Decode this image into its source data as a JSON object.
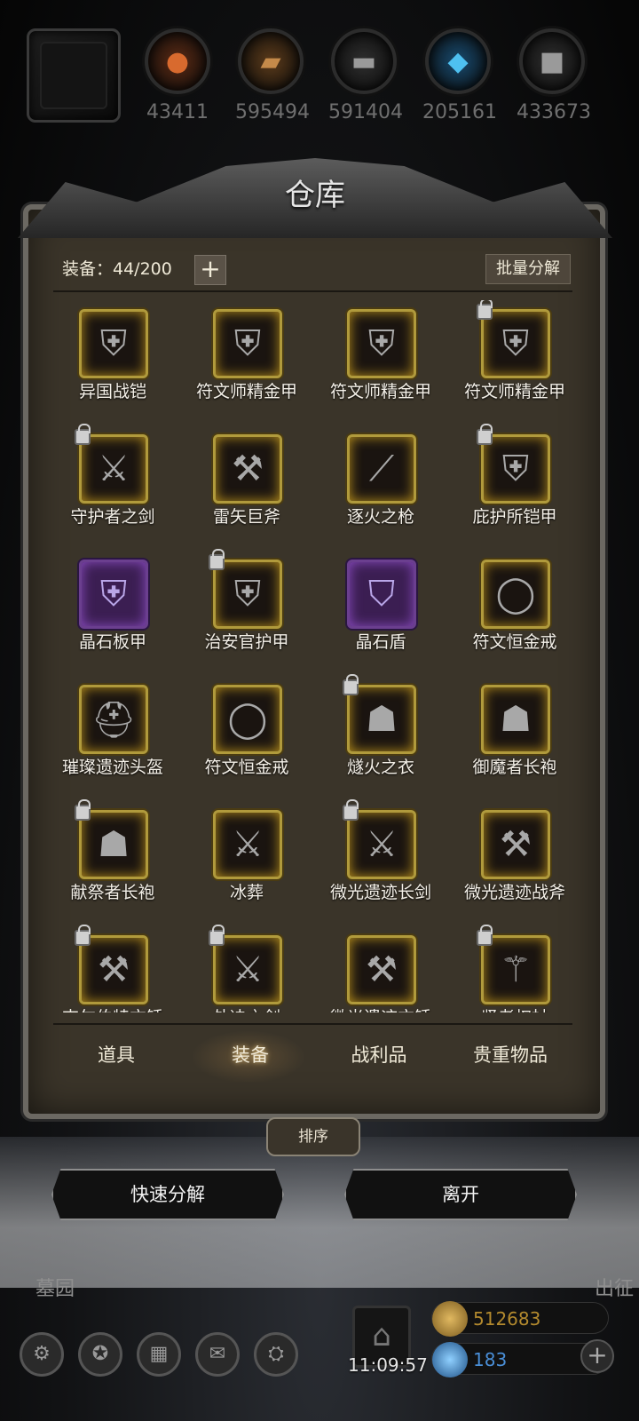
{
  "resources": [
    {
      "icon": "ore-icon",
      "glyph": "●",
      "value": "43411"
    },
    {
      "icon": "wood-icon",
      "glyph": "▰",
      "value": "595494"
    },
    {
      "icon": "iron-icon",
      "glyph": "▬",
      "value": "591404"
    },
    {
      "icon": "crystal-icon",
      "glyph": "◆",
      "value": "205161"
    },
    {
      "icon": "stone-icon",
      "glyph": "■",
      "value": "433673"
    }
  ],
  "panel": {
    "title": "仓库",
    "count_label": "装备：44/200",
    "add_label": "+",
    "batch_label": "批量分解"
  },
  "items": [
    {
      "name": "异国战铠",
      "icon": "armor-icon",
      "glyph": "⛨",
      "locked": false,
      "epic": false
    },
    {
      "name": "符文师精金甲",
      "icon": "armor-icon",
      "glyph": "⛨",
      "locked": false,
      "epic": false
    },
    {
      "name": "符文师精金甲",
      "icon": "armor-icon",
      "glyph": "⛨",
      "locked": false,
      "epic": false
    },
    {
      "name": "符文师精金甲",
      "icon": "armor-icon",
      "glyph": "⛨",
      "locked": true,
      "epic": false
    },
    {
      "name": "守护者之剑",
      "icon": "sword-icon",
      "glyph": "⚔",
      "locked": true,
      "epic": false
    },
    {
      "name": "雷矢巨斧",
      "icon": "axe-icon",
      "glyph": "⚒",
      "locked": false,
      "epic": false
    },
    {
      "name": "逐火之枪",
      "icon": "spear-icon",
      "glyph": "⟋",
      "locked": false,
      "epic": false
    },
    {
      "name": "庇护所铠甲",
      "icon": "armor-icon",
      "glyph": "⛨",
      "locked": true,
      "epic": false
    },
    {
      "name": "晶石板甲",
      "icon": "armor-icon",
      "glyph": "⛨",
      "locked": false,
      "epic": true
    },
    {
      "name": "治安官护甲",
      "icon": "armor-icon",
      "glyph": "⛨",
      "locked": true,
      "epic": false
    },
    {
      "name": "晶石盾",
      "icon": "shield-icon",
      "glyph": "⛉",
      "locked": false,
      "epic": true
    },
    {
      "name": "符文恒金戒",
      "icon": "ring-icon",
      "glyph": "◯",
      "locked": false,
      "epic": false
    },
    {
      "name": "璀璨遗迹头盔",
      "icon": "helmet-icon",
      "glyph": "⛑",
      "locked": false,
      "epic": false
    },
    {
      "name": "符文恒金戒",
      "icon": "ring-icon",
      "glyph": "◯",
      "locked": false,
      "epic": false
    },
    {
      "name": "燧火之衣",
      "icon": "robe-icon",
      "glyph": "☗",
      "locked": true,
      "epic": false
    },
    {
      "name": "御魔者长袍",
      "icon": "robe-icon",
      "glyph": "☗",
      "locked": false,
      "epic": false
    },
    {
      "name": "献祭者长袍",
      "icon": "robe-icon",
      "glyph": "☗",
      "locked": true,
      "epic": false
    },
    {
      "name": "冰葬",
      "icon": "sword-icon",
      "glyph": "⚔",
      "locked": false,
      "epic": false
    },
    {
      "name": "微光遗迹长剑",
      "icon": "sword-icon",
      "glyph": "⚔",
      "locked": true,
      "epic": false
    },
    {
      "name": "微光遗迹战斧",
      "icon": "axe-icon",
      "glyph": "⚒",
      "locked": false,
      "epic": false
    },
    {
      "name": "吉尔伯特方锤",
      "icon": "hammer-icon",
      "glyph": "⚒",
      "locked": true,
      "epic": false
    },
    {
      "name": "处决之剑",
      "icon": "sword-icon",
      "glyph": "⚔",
      "locked": true,
      "epic": false
    },
    {
      "name": "微光遗迹方锤",
      "icon": "hammer-icon",
      "glyph": "⚒",
      "locked": false,
      "epic": false
    },
    {
      "name": "贤者权杖",
      "icon": "staff-icon",
      "glyph": "⚚",
      "locked": true,
      "epic": false
    }
  ],
  "tabs": [
    {
      "label": "道具",
      "active": false
    },
    {
      "label": "装备",
      "active": true
    },
    {
      "label": "战利品",
      "active": false
    },
    {
      "label": "贵重物品",
      "active": false
    }
  ],
  "buttons": {
    "sort": "排序",
    "quick_decompose": "快速分解",
    "leave": "离开"
  },
  "bottom": {
    "map_label": "墓园",
    "depart_label": "出征",
    "timer": "11:09:57",
    "gold": "512683",
    "gems": "183",
    "plus": "+"
  },
  "colors": {
    "gold_frame": "#b09a3c",
    "epic_frame": "#6b3f8f",
    "gold_text": "#b38a2e",
    "gem_text": "#4a8fd8"
  }
}
